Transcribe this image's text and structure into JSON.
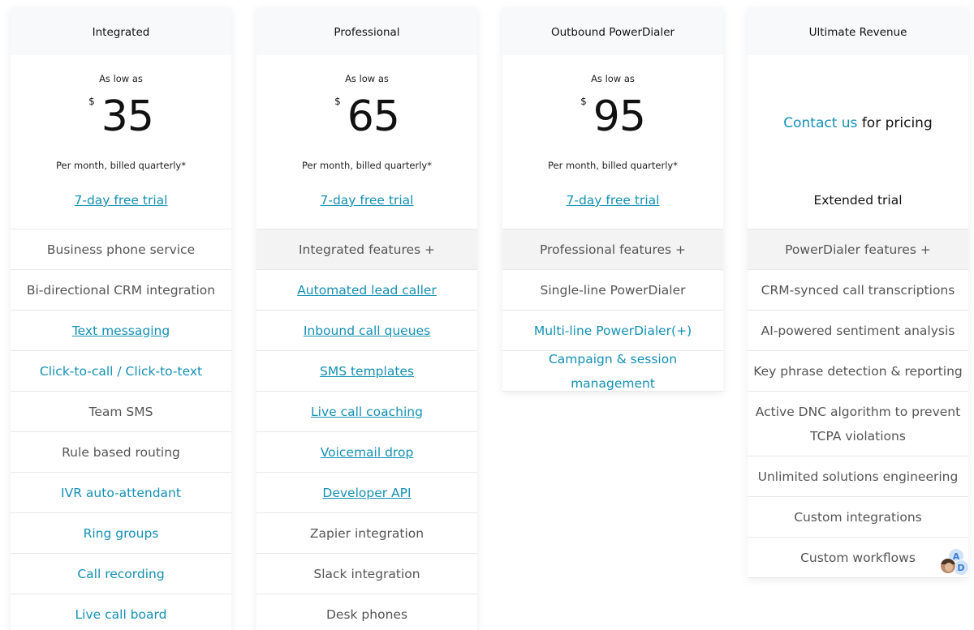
{
  "plans": [
    {
      "name": "Integrated",
      "as_low_as": "As low as",
      "currency": "$",
      "price": "35",
      "billing": "Per month, billed quarterly*",
      "trial": "7-day free trial",
      "features": [
        "Business phone service",
        "Bi-directional CRM integration",
        "Text messaging",
        "Click-to-call / Click-to-text",
        "Team SMS",
        "Rule based routing",
        "IVR auto-attendant",
        "Ring groups",
        "Call recording",
        "Live call board"
      ]
    },
    {
      "name": "Professional",
      "as_low_as": "As low as",
      "currency": "$",
      "price": "65",
      "billing": "Per month, billed quarterly*",
      "trial": "7-day free trial",
      "features": [
        "Integrated features +",
        "Automated lead caller",
        "Inbound call queues",
        "SMS templates",
        "Live call coaching",
        "Voicemail drop",
        "Developer API",
        "Zapier integration",
        "Slack integration",
        "Desk phones"
      ]
    },
    {
      "name": "Outbound PowerDialer",
      "as_low_as": "As low as",
      "currency": "$",
      "price": "95",
      "billing": "Per month, billed quarterly*",
      "trial": "7-day free trial",
      "features": [
        "Professional features +",
        "Single-line PowerDialer",
        "Multi-line PowerDialer(+)",
        "Campaign & session management"
      ]
    },
    {
      "name": "Ultimate Revenue",
      "contact_link": "Contact us",
      "contact_rest": " for pricing",
      "trial": "Extended trial",
      "features": [
        "PowerDialer features +",
        "CRM-synced call transcriptions",
        "AI-powered sentiment analysis",
        "Key phrase detection & reporting",
        "Active DNC algorithm to prevent TCPA violations",
        "Unlimited solutions engineering",
        "Custom integrations",
        "Custom workflows"
      ]
    }
  ],
  "chat_widget": {
    "initial_a": "A",
    "initial_d": "D"
  },
  "colors": {
    "link": "#1490b4",
    "header_bg": "#f7f9fb",
    "shaded_row": "#f3f3f3"
  }
}
